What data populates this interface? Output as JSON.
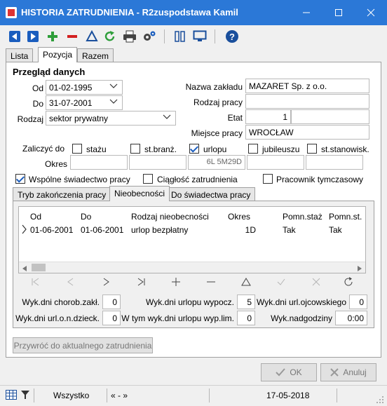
{
  "window": {
    "title": "HISTORIA ZATRUDNIENIA - R2zuspodstawa Kamil"
  },
  "main_tabs": [
    "Lista",
    "Pozycja",
    "Razem"
  ],
  "section_title": "Przegląd danych",
  "form": {
    "od_label": "Od",
    "od_value": "01-02-1995",
    "do_label": "Do",
    "do_value": "31-07-2001",
    "rodzaj_label": "Rodzaj",
    "rodzaj_value": "sektor prywatny",
    "okres_label": "Okres",
    "okres_value": "",
    "nazwa_label": "Nazwa zakładu",
    "nazwa_value": "MAZARET Sp. z o.o.",
    "rodzaj_pracy_label": "Rodzaj pracy",
    "rodzaj_pracy_value": "",
    "etat_label": "Etat",
    "etat_value": "1",
    "etat_extra": "",
    "miejsce_label": "Miejsce pracy",
    "miejsce_value": "WROCŁAW"
  },
  "zaliczyc": {
    "label": "Zaliczyć do",
    "items": [
      {
        "label": "stażu",
        "checked": false,
        "value": ""
      },
      {
        "label": "st.branż.",
        "checked": false,
        "value": ""
      },
      {
        "label": "urlopu",
        "checked": true,
        "value": "6L 5M29D"
      },
      {
        "label": "jubileuszu",
        "checked": false,
        "value": ""
      },
      {
        "label": "st.stanowisk.",
        "checked": false,
        "value": ""
      }
    ]
  },
  "flags": {
    "wspolne": "Wspólne świadectwo pracy",
    "ciaglosc": "Ciągłość zatrudnienia",
    "tymczasowy": "Pracownik tymczasowy"
  },
  "sub_tabs": [
    "Tryb zakończenia pracy",
    "Nieobecności",
    "Do świadectwa pracy"
  ],
  "grid": {
    "columns": [
      "Od",
      "Do",
      "Rodzaj nieobecności",
      "Okres",
      "Pomn.staż",
      "Pomn.st."
    ],
    "rows": [
      {
        "od": "01-06-2001",
        "do": "01-06-2001",
        "rodzaj": "urlop bezpłatny",
        "okres": "1D",
        "pomn_staz": "Tak",
        "pomn_st": "Tak"
      }
    ]
  },
  "summary": {
    "chorob_label": "Wyk.dni chorob.zakł.",
    "chorob_value": "0",
    "urlopu_label": "Wyk.dni urlopu wypocz.",
    "urlopu_value": "5",
    "ojcowskiego_label": "Wyk.dni url.ojcowskiego",
    "ojcowskiego_value": "0",
    "opieka_label": "Wyk.dni url.o.n.dzieck.",
    "opieka_value": "0",
    "wymiar_label": "W tym wyk.dni urlopu wyp.lim.",
    "wymiar_value": "0",
    "nadgodziny_label": "Wyk.nadgodziny",
    "nadgodziny_value": "0:00"
  },
  "restore_button": "Przywróć do aktualnego zatrudnienia",
  "ok_button": "OK",
  "cancel_button": "Anuluj",
  "status": {
    "filter": "Wszystko",
    "range": "« - »",
    "date": "17-05-2018"
  },
  "colors": {
    "titlebar": "#2b78d7",
    "accent_green": "#2e9e3a",
    "accent_red": "#d32020",
    "accent_blue": "#1a5dbe"
  }
}
